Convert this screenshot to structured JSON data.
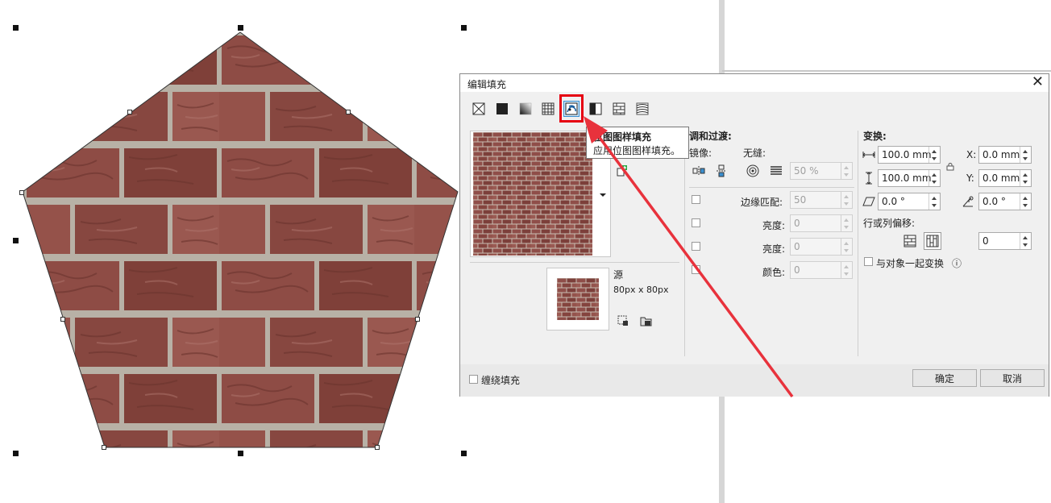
{
  "dialog": {
    "title": "编辑填充",
    "close_glyph": "✕",
    "fill_types": [
      {
        "name": "no-fill",
        "icon": "no-fill-icon"
      },
      {
        "name": "uniform-fill",
        "icon": "uniform-fill-icon"
      },
      {
        "name": "fountain-fill",
        "icon": "fountain-fill-icon"
      },
      {
        "name": "vector-pattern-fill",
        "icon": "vector-pattern-icon"
      },
      {
        "name": "bitmap-pattern-fill",
        "icon": "bitmap-pattern-icon",
        "active": true
      },
      {
        "name": "two-color-pattern-fill",
        "icon": "two-color-pattern-icon"
      },
      {
        "name": "texture-fill",
        "icon": "texture-fill-icon"
      },
      {
        "name": "postscript-fill",
        "icon": "postscript-fill-icon"
      }
    ],
    "tooltip": {
      "title": "位图图样填充",
      "description": "应用位图图样填充。"
    },
    "blend": {
      "heading": "调和过渡:",
      "mirror_label": "镜像:",
      "seamless_label": "无缝:",
      "seamless_value": "50 %",
      "edge_match_label": "边缘匹配:",
      "edge_match_value": "50",
      "brightness_label": "亮度:",
      "brightness_value": "0",
      "luminance_label": "亮度:",
      "luminance_value": "0",
      "color_label": "颜色:",
      "color_value": "0"
    },
    "source": {
      "label": "源",
      "size": "80px x 80px"
    },
    "transform": {
      "heading": "变换:",
      "width": "100.0 mm",
      "height": "100.0 mm",
      "x_label": "X:",
      "x_value": "0.0 mm",
      "y_label": "Y:",
      "y_value": "0.0 mm",
      "skew": "0.0 °",
      "rotate": "0.0 °",
      "offset_label": "行或列偏移:",
      "offset_value": "0",
      "transform_with_object": "与对象一起变换",
      "info_glyph": "ⓘ"
    },
    "wrap_fill_label": "缠绕填充",
    "ok_label": "确定",
    "cancel_label": "取消"
  },
  "colors": {
    "brick": "#8c4a44",
    "mortar": "#b9b2a8",
    "arrow": "#e8323c",
    "highlight": "#e60012",
    "selection": "#cde6f7"
  }
}
